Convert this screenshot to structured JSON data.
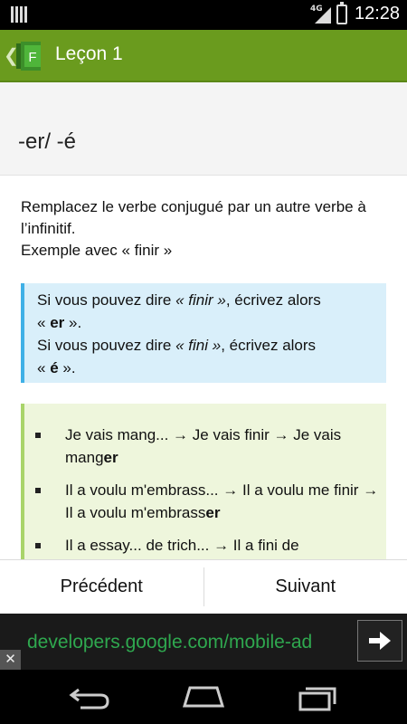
{
  "status_bar": {
    "network": "4G",
    "time": "12:28"
  },
  "action_bar": {
    "title": "Leçon 1",
    "app_icon_letter": "F"
  },
  "lesson": {
    "heading": "-er/ -é",
    "intro_lines": [
      "Remplacez le verbe conjugué par un autre verbe à l’infinitif.",
      "Exemple avec « finir »"
    ],
    "info": {
      "line1_prefix": "Si vous pouvez dire ",
      "line1_em": "« finir »",
      "line1_suffix": ", écrivez alors",
      "line2_prefix": "« ",
      "line2_bold": "er",
      "line2_suffix": " ».",
      "line3_prefix": "Si vous pouvez dire ",
      "line3_em": "« fini »",
      "line3_suffix": ", écrivez alors",
      "line4_prefix": "« ",
      "line4_bold": "é",
      "line4_suffix": " »."
    },
    "examples": [
      {
        "text": "Je vais mang... → Je vais finir → Je vais mang",
        "bold": "er",
        "tail": ""
      },
      {
        "text": "Il a voulu m'embrass... → Il a voulu me finir → Il a voulu m'embrass",
        "bold": "er",
        "tail": ""
      },
      {
        "text": "Il a essay... de trich... → Il a fini de",
        "bold": "",
        "tail": ""
      }
    ]
  },
  "buttons": {
    "previous": "Précédent",
    "next": "Suivant"
  },
  "ad": {
    "url": "developers.google.com/mobile-ad",
    "close": "✕"
  },
  "colors": {
    "action_bar": "#6a9b1e",
    "info_border": "#3fb0e6",
    "example_border": "#a9d46a",
    "ad_text": "#2fa84f"
  }
}
